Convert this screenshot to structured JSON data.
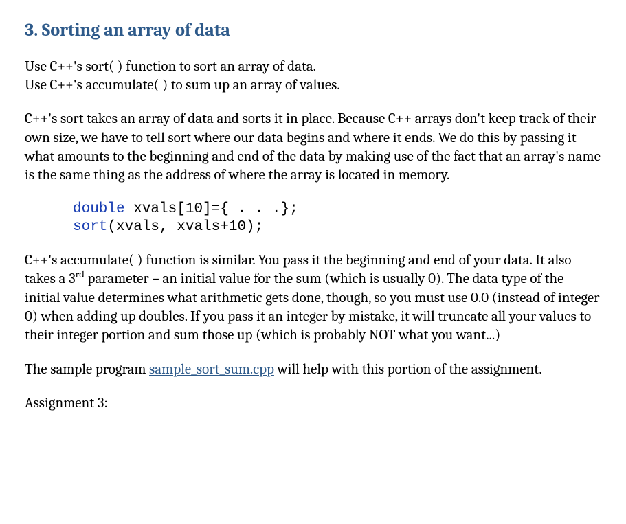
{
  "section": {
    "title": "3.  Sorting an array of data"
  },
  "paragraphs": {
    "intro_line1": "Use C++'s sort( ) function to sort an array of data.",
    "intro_line2": "Use C++'s accumulate( ) to sum up an array of values.",
    "sort_expl": "C++'s sort takes an array of data and sorts it in place.  Because C++ arrays don't keep track of their own size, we have to tell sort where our data begins and where it ends.  We do this by passing it what amounts to the beginning and end of the data by making use of the fact that an array's name is the same thing as the address of where the array is located in memory.",
    "accum_pre": "C++'s accumulate( ) function is similar.  You pass it the beginning and end of your data.  It also takes a 3",
    "accum_sup": "rd",
    "accum_post": " parameter – an initial value for the sum (which is usually 0).  The data type of the initial value determines what arithmetic gets done, though, so you must use 0.0 (instead of integer 0) when adding up doubles.  If you pass it an integer by mistake, it will truncate all your values to their integer portion and sum those up (which is probably NOT what you want...)",
    "sample_pre": "The sample program ",
    "sample_link": "sample_sort_sum.cpp",
    "sample_post": " will help with this portion of the assignment.",
    "assign_label": "Assignment 3:"
  },
  "code": {
    "kw_double": "double",
    "line1_rest": " xvals[10]={ . . .};",
    "fn_sort": "sort",
    "line2_rest": "(xvals, xvals+10);"
  }
}
